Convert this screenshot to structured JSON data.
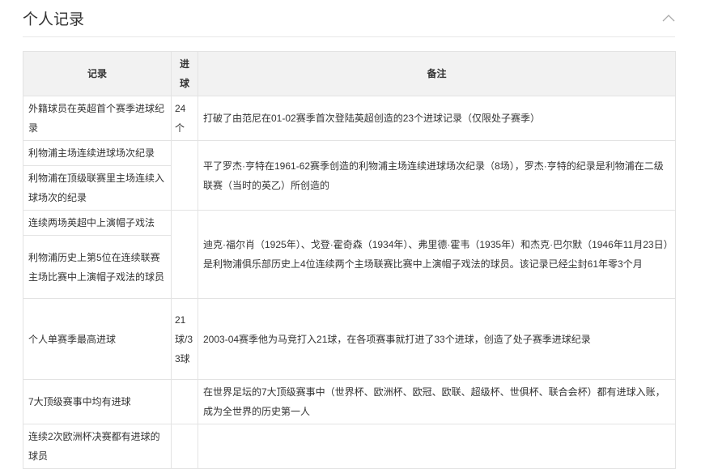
{
  "section": {
    "title": "个人记录",
    "collapse_icon": "chevron-up-icon"
  },
  "table": {
    "headers": [
      "记录",
      "进球",
      "备注"
    ],
    "rows": [
      {
        "record": "外籍球员在英超首个赛季进球纪录",
        "goals": "24个",
        "note": "打破了由范尼在01-02赛季首次登陆英超创造的23个进球记录（仅限处子赛季）"
      },
      {
        "record": "利物浦主场连续进球场次纪录",
        "goals": "",
        "note": "平了罗杰·亨特在1961-62赛季创造的利物浦主场连续进球场次纪录（8场），罗杰·亨特的纪录是利物浦在二级联赛（当时的英乙）所创造的"
      },
      {
        "record": "利物浦在顶级联赛里主场连续入球场次的纪录"
      },
      {
        "record": "连续两场英超中上演帽子戏法",
        "goals": "",
        "note": "迪克·福尔肖（1925年）、戈登·霍奇森（1934年）、弗里德·霍韦（1935年）和杰克·巴尔默（1946年11月23日）是利物浦俱乐部历史上4位连续两个主场联赛比赛中上演帽子戏法的球员。该记录已经尘封61年零3个月"
      },
      {
        "record": "利物浦历史上第5位在连续联赛主场比赛中上演帽子戏法的球员"
      },
      {
        "record": "个人单赛季最高进球",
        "goals": "21球/33球",
        "note": "2003-04赛季他为马竞打入21球，在各项赛事就打进了33个进球，创造了处子赛季进球纪录"
      },
      {
        "record": "7大顶级赛事中均有进球",
        "goals": "",
        "note": "在世界足坛的7大顶级赛事中（世界杯、欧洲杯、欧冠、欧联、超级杯、世俱杯、联合会杯）都有进球入账，成为全世界的历史第一人"
      },
      {
        "record": "连续2次欧洲杯决赛都有进球的球员",
        "goals": "",
        "note": ""
      }
    ]
  }
}
